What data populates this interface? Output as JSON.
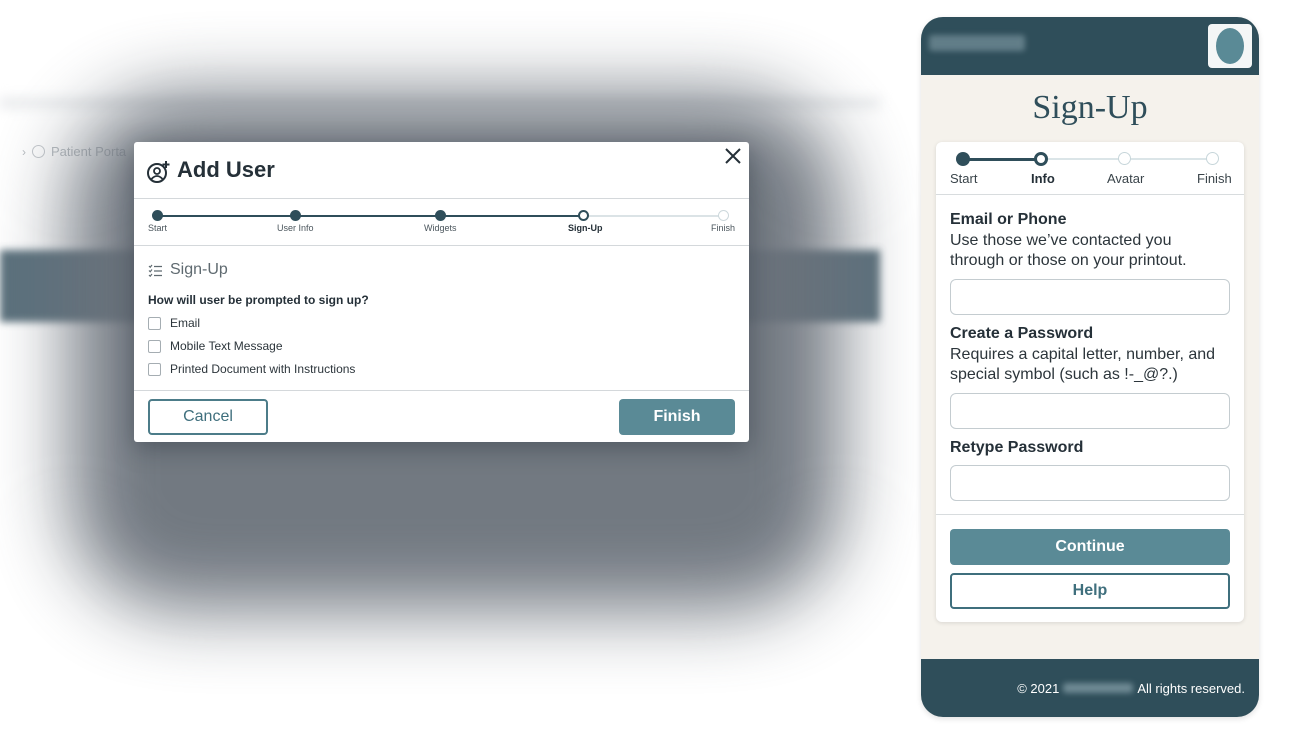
{
  "background": {
    "breadcrumb": "Patient Porta"
  },
  "modal": {
    "title": "Add User",
    "steps": [
      {
        "label": "Start",
        "state": "done"
      },
      {
        "label": "User Info",
        "state": "done"
      },
      {
        "label": "Widgets",
        "state": "done"
      },
      {
        "label": "Sign-Up",
        "state": "current"
      },
      {
        "label": "Finish",
        "state": "todo"
      }
    ],
    "section_title": "Sign-Up",
    "question": "How will user be prompted to sign up?",
    "options": [
      {
        "label": "Email",
        "checked": false
      },
      {
        "label": "Mobile Text Message",
        "checked": false
      },
      {
        "label": "Printed Document with Instructions",
        "checked": false
      }
    ],
    "cancel_label": "Cancel",
    "finish_label": "Finish"
  },
  "phone": {
    "title": "Sign-Up",
    "steps": [
      {
        "label": "Start",
        "state": "done"
      },
      {
        "label": "Info",
        "state": "current"
      },
      {
        "label": "Avatar",
        "state": "todo"
      },
      {
        "label": "Finish",
        "state": "todo"
      }
    ],
    "fields": [
      {
        "label": "Email or Phone",
        "help": "Use those we’ve contacted you through or those on your printout.",
        "value": ""
      },
      {
        "label": "Create a Password",
        "help": "Requires a capital letter, number, and special symbol (such as !-_@?.)",
        "value": ""
      },
      {
        "label": "Retype Password",
        "help": "",
        "value": ""
      }
    ],
    "continue_label": "Continue",
    "help_label": "Help",
    "footer": {
      "copyright": "© 2021",
      "rights": "All rights reserved."
    }
  },
  "colors": {
    "primary_dark": "#2f4e5a",
    "primary": "#5a8a96",
    "phone_bg": "#f5f2ec"
  }
}
